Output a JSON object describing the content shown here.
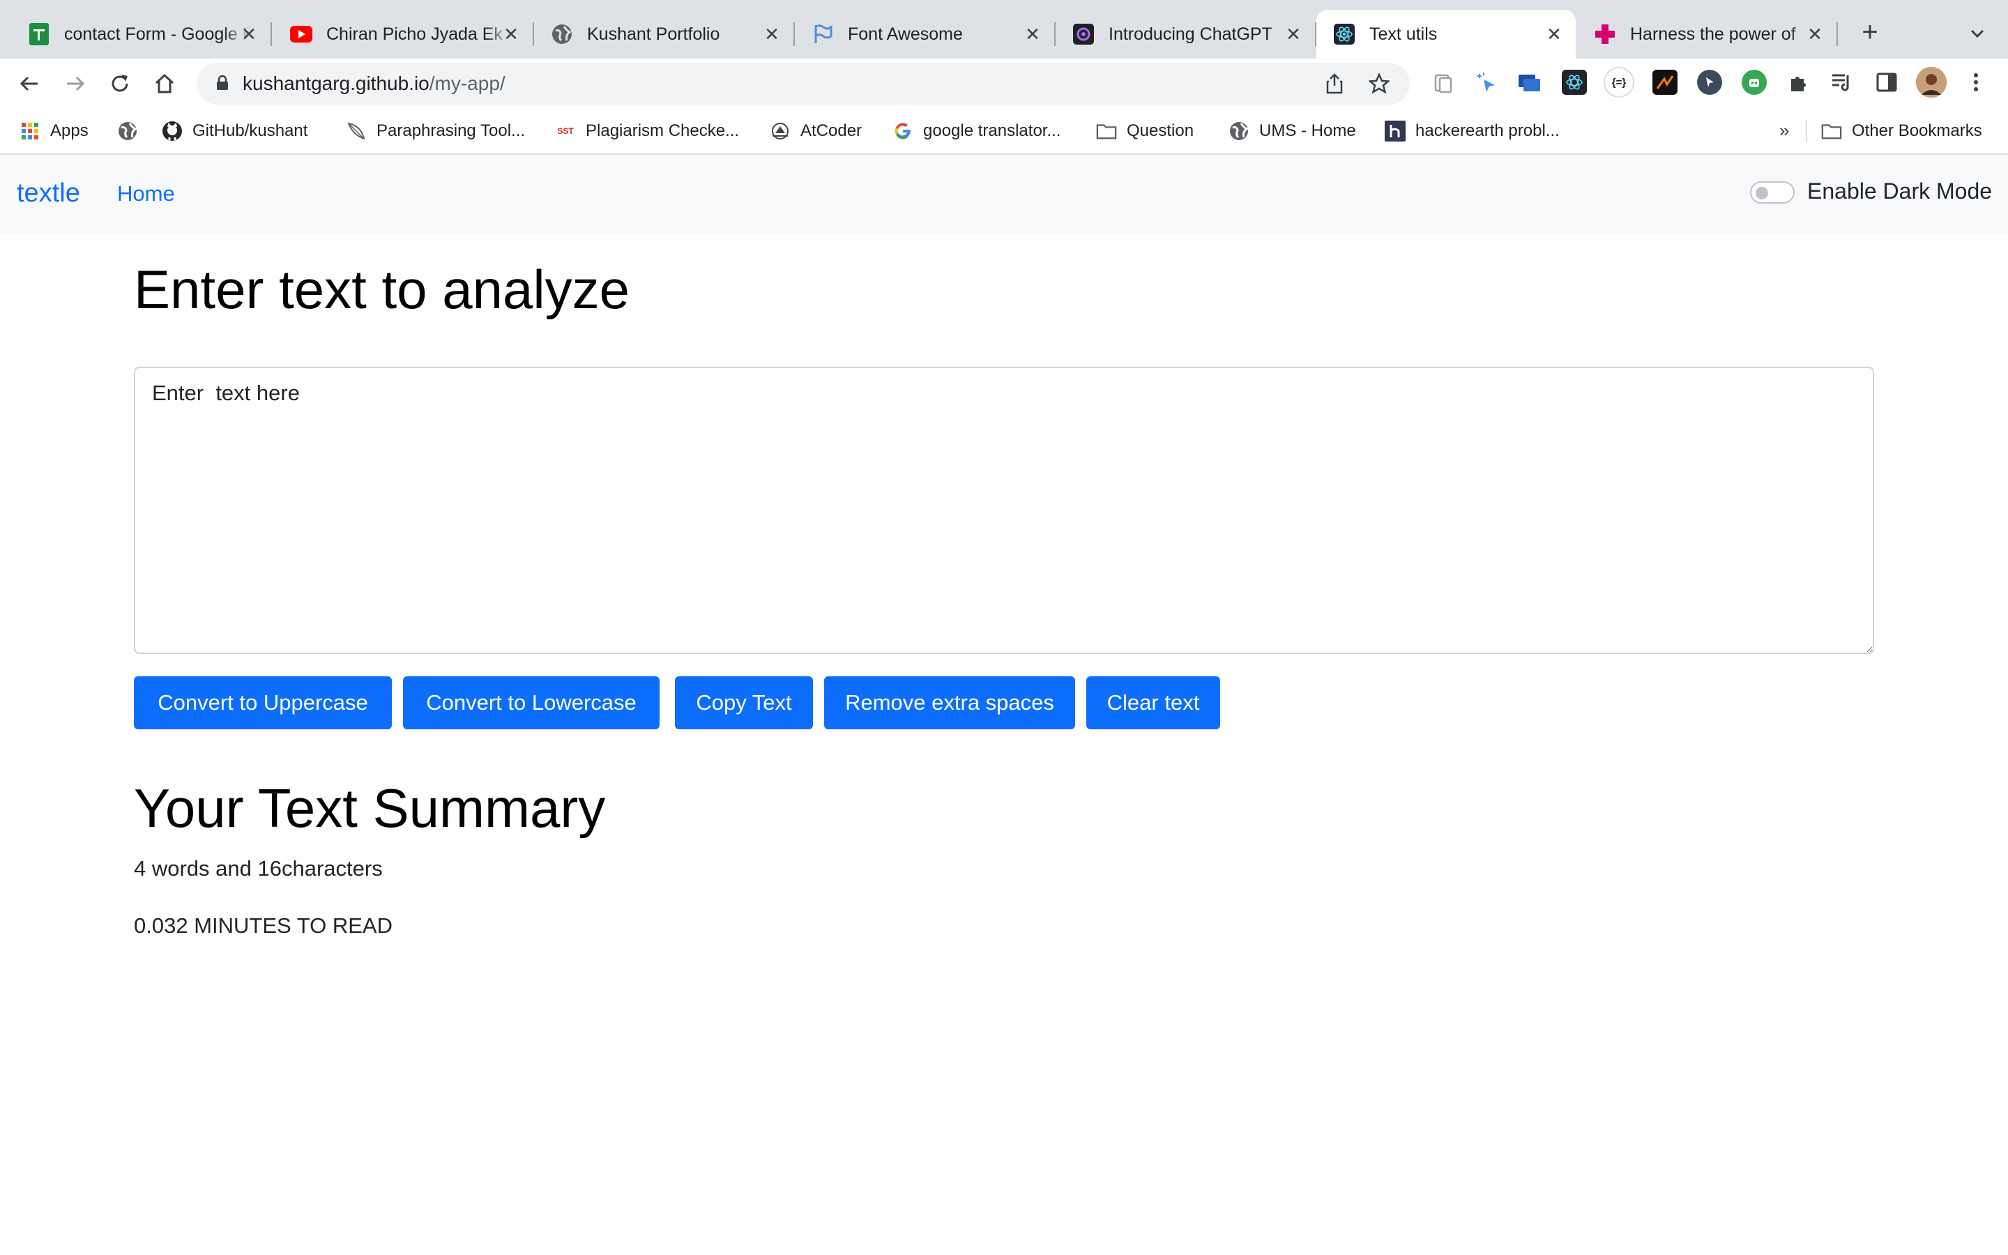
{
  "browser": {
    "tabs": [
      {
        "title": "contact Form - Google Forms",
        "favicon": "google-forms-icon",
        "color": "#1e8e3e"
      },
      {
        "title": "Chiran Picho Jyada Ek",
        "favicon": "youtube-icon",
        "color": "#ff0000"
      },
      {
        "title": "Kushant Portfolio",
        "favicon": "globe-icon",
        "color": "#5f6368"
      },
      {
        "title": "Font Awesome",
        "favicon": "flag-icon",
        "color": "#528dd7"
      },
      {
        "title": "Introducing ChatGPT",
        "favicon": "openai-icon",
        "color": "#202123"
      },
      {
        "title": "Text utils",
        "favicon": "react-icon",
        "color": "#61dafb",
        "active": true
      },
      {
        "title": "Harness the power of",
        "favicon": "plus-brand-icon",
        "color": "#d6006f"
      }
    ],
    "address": {
      "domain": "kushantgarg.github.io",
      "path": "/my-app/"
    },
    "bookmarks": [
      {
        "label": "Apps",
        "icon": "apps-grid-icon"
      },
      {
        "label": "",
        "icon": "globe-icon"
      },
      {
        "label": "GitHub/kushant",
        "icon": "github-icon"
      },
      {
        "label": "Paraphrasing Tool...",
        "icon": "feather-icon"
      },
      {
        "label": "Plagiarism Checke...",
        "icon": "sst-icon"
      },
      {
        "label": "AtCoder",
        "icon": "atcoder-icon"
      },
      {
        "label": "google translator...",
        "icon": "google-icon"
      },
      {
        "label": "Question",
        "icon": "folder-icon"
      },
      {
        "label": "UMS - Home",
        "icon": "globe-icon"
      },
      {
        "label": "hackerearth probl...",
        "icon": "hackerearth-icon"
      }
    ],
    "bookmarks_overflow": "»",
    "other_bookmarks": "Other Bookmarks",
    "sst_text": "SST",
    "ext_braces": "{=}"
  },
  "app": {
    "brand": "textle",
    "nav_home": "Home",
    "dark_mode_label": "Enable Dark Mode",
    "heading": "Enter text to analyze",
    "textarea_value": "Enter  text here",
    "buttons": {
      "uppercase": "Convert to Uppercase",
      "lowercase": "Convert to Lowercase",
      "copy": "Copy Text",
      "remove_spaces": "Remove extra spaces",
      "clear": "Clear text"
    },
    "summary_heading": "Your Text Summary",
    "summary_counts": "4 words and 16characters",
    "summary_read": "0.032 MINUTES TO READ",
    "colors": {
      "primary": "#0d6efd",
      "nav_bg": "#f8f9fa"
    }
  }
}
